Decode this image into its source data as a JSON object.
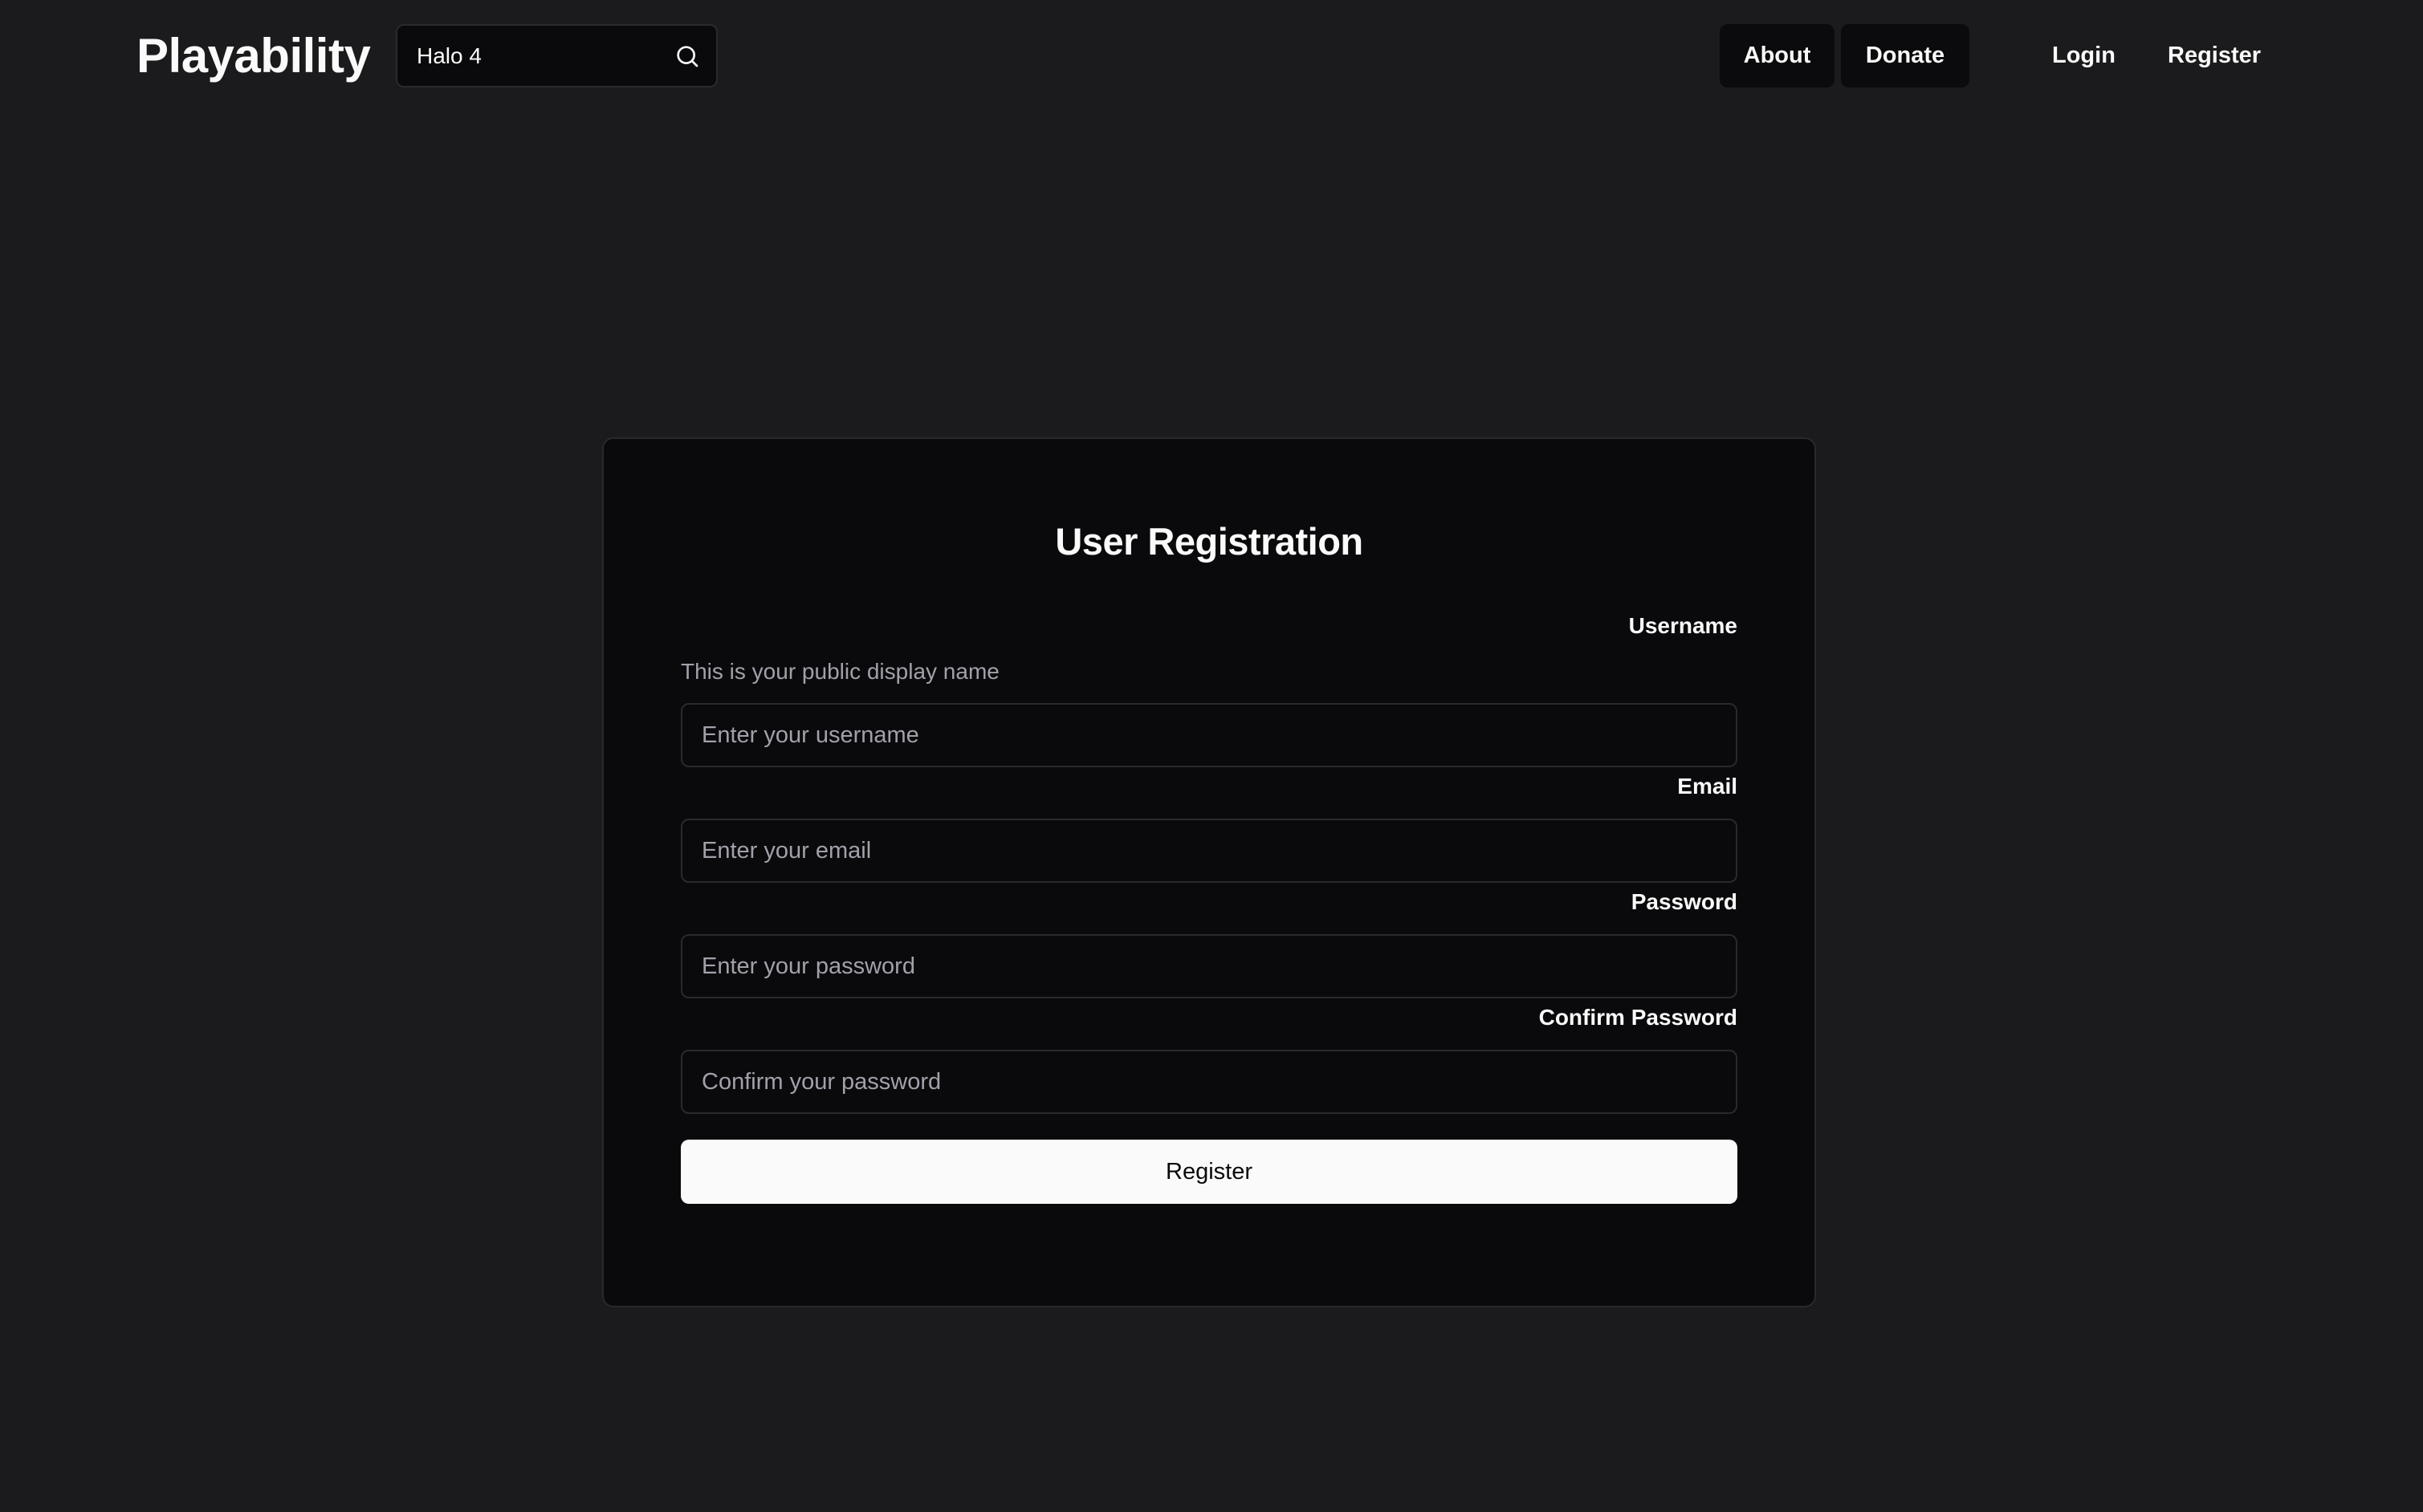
{
  "header": {
    "logo": "Playability",
    "search": {
      "value": "Halo 4",
      "icon": "search-icon"
    },
    "nav": {
      "about": "About",
      "donate": "Donate",
      "login": "Login",
      "register": "Register"
    }
  },
  "form": {
    "title": "User Registration",
    "username": {
      "label": "Username",
      "helper": "This is your public display name",
      "placeholder": "Enter your username"
    },
    "email": {
      "label": "Email",
      "placeholder": "Enter your email"
    },
    "password": {
      "label": "Password",
      "placeholder": "Enter your password"
    },
    "confirm_password": {
      "label": "Confirm Password",
      "placeholder": "Confirm your password"
    },
    "submit_label": "Register"
  },
  "colors": {
    "page_background": "#1b1b1d",
    "card_background": "#0a0a0c",
    "primary_button": "#fafafa",
    "muted_text": "#a1a1aa"
  }
}
